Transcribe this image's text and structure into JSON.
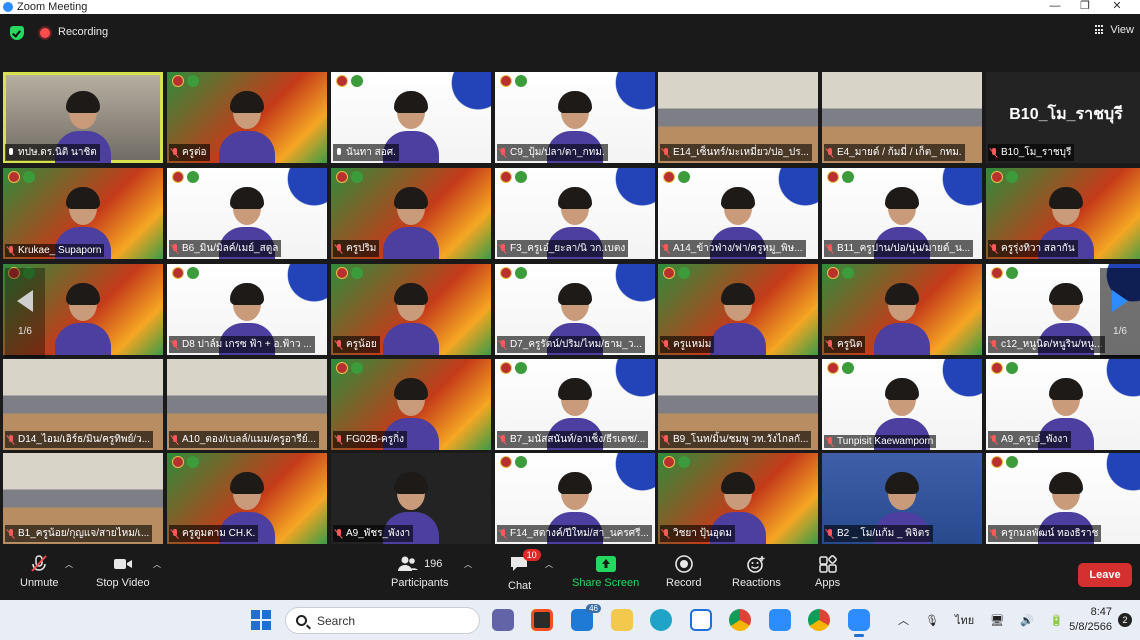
{
  "window": {
    "title": "Zoom Meeting",
    "min": "—",
    "max": "❐",
    "close": "✕"
  },
  "topbar": {
    "recording_label": "Recording",
    "view_label": "View"
  },
  "gallery": {
    "page_indicator": "1/6",
    "tiles": [
      {
        "name": "ทปษ.ดร.นิติ นาชิต",
        "bg": "bg-gray",
        "muted": false,
        "active": true
      },
      {
        "name": "ครูต่อ",
        "bg": "bg-green",
        "muted": true
      },
      {
        "name": "นันทา สอศ.",
        "bg": "bg-white",
        "muted": false
      },
      {
        "name": "C9_ปุ้ม/ปลา/ดา_กทม.",
        "bg": "bg-white",
        "muted": true
      },
      {
        "name": "E14_เซ็นทร์/มะเหมี่ยว/ปอ_ปร...",
        "bg": "bg-room",
        "muted": true
      },
      {
        "name": "E4_มายด์ / ก้มมี่ / เก็ต_ กทม.",
        "bg": "bg-room",
        "muted": true
      },
      {
        "name": "B10_โม_ราชบุรี",
        "bg": "bg-dark",
        "muted": true,
        "big": "B10_โม_ราชบุรี"
      },
      {
        "name": "Krukae_ Supaporn",
        "bg": "bg-green",
        "muted": true
      },
      {
        "name": "B6_มิน/มิลค์/เมย์_สตูล",
        "bg": "bg-white",
        "muted": true
      },
      {
        "name": "ครูปริม",
        "bg": "bg-green",
        "muted": true
      },
      {
        "name": "F3_ครูเอ๋_ยะลา/นิ วก.เบตง",
        "bg": "bg-white",
        "muted": true
      },
      {
        "name": "A14_ข้าวฟ่าง/ฟา/ครูหมู_พิษ...",
        "bg": "bg-white",
        "muted": true
      },
      {
        "name": "B11_ครูปาน/ปอ/นุ่น/มายด์_น...",
        "bg": "bg-white",
        "muted": true
      },
      {
        "name": "ครูรุ่งทิวา สลากัน",
        "bg": "bg-green",
        "muted": true
      },
      {
        "name": "",
        "bg": "bg-green",
        "muted": false
      },
      {
        "name": "D8 ปาล์ม เกรซ ฟ้า + อ.ฟ้าว ...",
        "bg": "bg-white",
        "muted": true
      },
      {
        "name": "ครูน้อย",
        "bg": "bg-green",
        "muted": true
      },
      {
        "name": "D7_ครูรัตน์/ปริม/ไหม/ธาม_ว...",
        "bg": "bg-white",
        "muted": true
      },
      {
        "name": "ครูแหม่ม",
        "bg": "bg-green",
        "muted": true
      },
      {
        "name": "ครูนิต",
        "bg": "bg-green",
        "muted": true
      },
      {
        "name": "c12_หนูนิด/หนูริน/หนู...",
        "bg": "bg-white",
        "muted": true
      },
      {
        "name": "D14_ไอม/เอิร์ธ/มิน/ครูทิพย์/ว...",
        "bg": "bg-room",
        "muted": true
      },
      {
        "name": "A10_ตอง/เบลล์/แมม/ครูอารีย์...",
        "bg": "bg-room",
        "muted": true
      },
      {
        "name": "FG02B-ครูกิ่ง",
        "bg": "bg-green",
        "muted": true
      },
      {
        "name": "B7_มนัสสนันท์/อาเซ็ง/ธีรเดช/...",
        "bg": "bg-white",
        "muted": true
      },
      {
        "name": "B9_โนท/มิ้น/ชมพู วท.วังไกลกั...",
        "bg": "bg-room",
        "muted": true
      },
      {
        "name": "Tunpisit Kaewamporn",
        "bg": "bg-white",
        "muted": true
      },
      {
        "name": "A9_ครูเอ๋_พังงา",
        "bg": "bg-white",
        "muted": true
      },
      {
        "name": "B1_ครูน้อย/กุญแจ/สายไหม/เ...",
        "bg": "bg-room",
        "muted": true
      },
      {
        "name": "ครูตูมตาม CH.K.",
        "bg": "bg-green",
        "muted": true
      },
      {
        "name": "A9_พัชร_พังงา",
        "bg": "bg-dark",
        "muted": true
      },
      {
        "name": "F14_สตางค์/ปีใหม่/สา_นครศรี...",
        "bg": "bg-white",
        "muted": true
      },
      {
        "name": "วิชยา ปุ้นอุดม",
        "bg": "bg-green",
        "muted": true
      },
      {
        "name": "B2 _ โม/แก้ม _ พิจิตร",
        "bg": "bg-blue",
        "muted": true
      },
      {
        "name": "ครูกมลพัฒน์ ทองธิราช",
        "bg": "bg-white",
        "muted": true
      }
    ]
  },
  "toolbar": {
    "unmute": "Unmute",
    "stop_video": "Stop Video",
    "participants": "Participants",
    "participants_count": "196",
    "chat": "Chat",
    "chat_badge": "10",
    "share_screen": "Share Screen",
    "record": "Record",
    "reactions": "Reactions",
    "apps": "Apps",
    "leave": "Leave",
    "share_color": "#23d95f"
  },
  "taskbar": {
    "search_placeholder": "Search",
    "mail_badge": "46",
    "lang": "ไทย",
    "time": "8:47",
    "date": "5/8/2566",
    "notifications": "2"
  }
}
